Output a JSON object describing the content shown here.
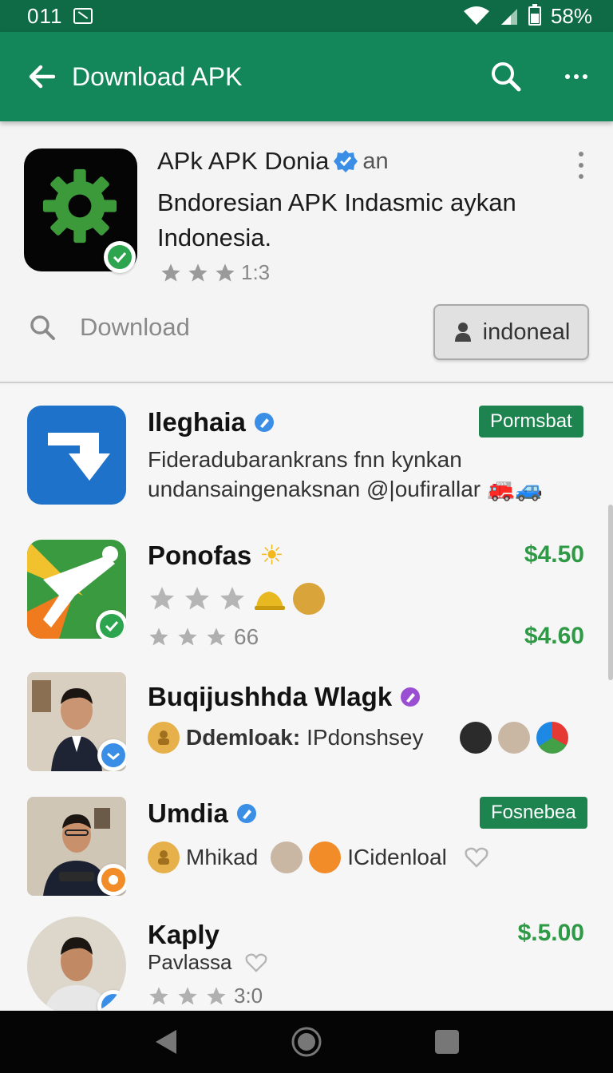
{
  "status_bar": {
    "time": "011",
    "battery": "58%",
    "battery_level": 0.58
  },
  "app_bar": {
    "title": "Download APK"
  },
  "header": {
    "title": "APk APK Donia",
    "title_suffix": "an",
    "description": "Bndoresian APK Indasmic aykan Indonesia.",
    "rating_text": "1:3",
    "download_label": "Download",
    "region_button_label": "indoneal"
  },
  "list": {
    "items": [
      {
        "name": "Ileghaia",
        "tag": "Pormsbat",
        "line1": "Fideradubarankrans fnn kynkan",
        "line2": "undansaingenaksnan @|oufirallar",
        "line2_emojis": "🚒🚙"
      },
      {
        "name": "Ponofas",
        "name_emoji": "☀",
        "price1": "$4.50",
        "price2": "$4.60",
        "rating_text": "66"
      },
      {
        "name": "Buqijushhda Wlagk",
        "subtitle_bold": "Ddemloak:",
        "subtitle_rest": "IPdonshsey"
      },
      {
        "name": "Umdia",
        "tag": "Fosnebea",
        "meta1": "Mhikad",
        "meta2": "ICidenloal"
      },
      {
        "name": "Kaply",
        "subtitle": "Pavlassa",
        "price": "$.5.00",
        "rating_text": "3:0"
      }
    ]
  },
  "colors": {
    "appbar": "#14875a",
    "statusbar": "#0f6b45",
    "accent": "#1d8450",
    "price": "#2e9a45"
  }
}
